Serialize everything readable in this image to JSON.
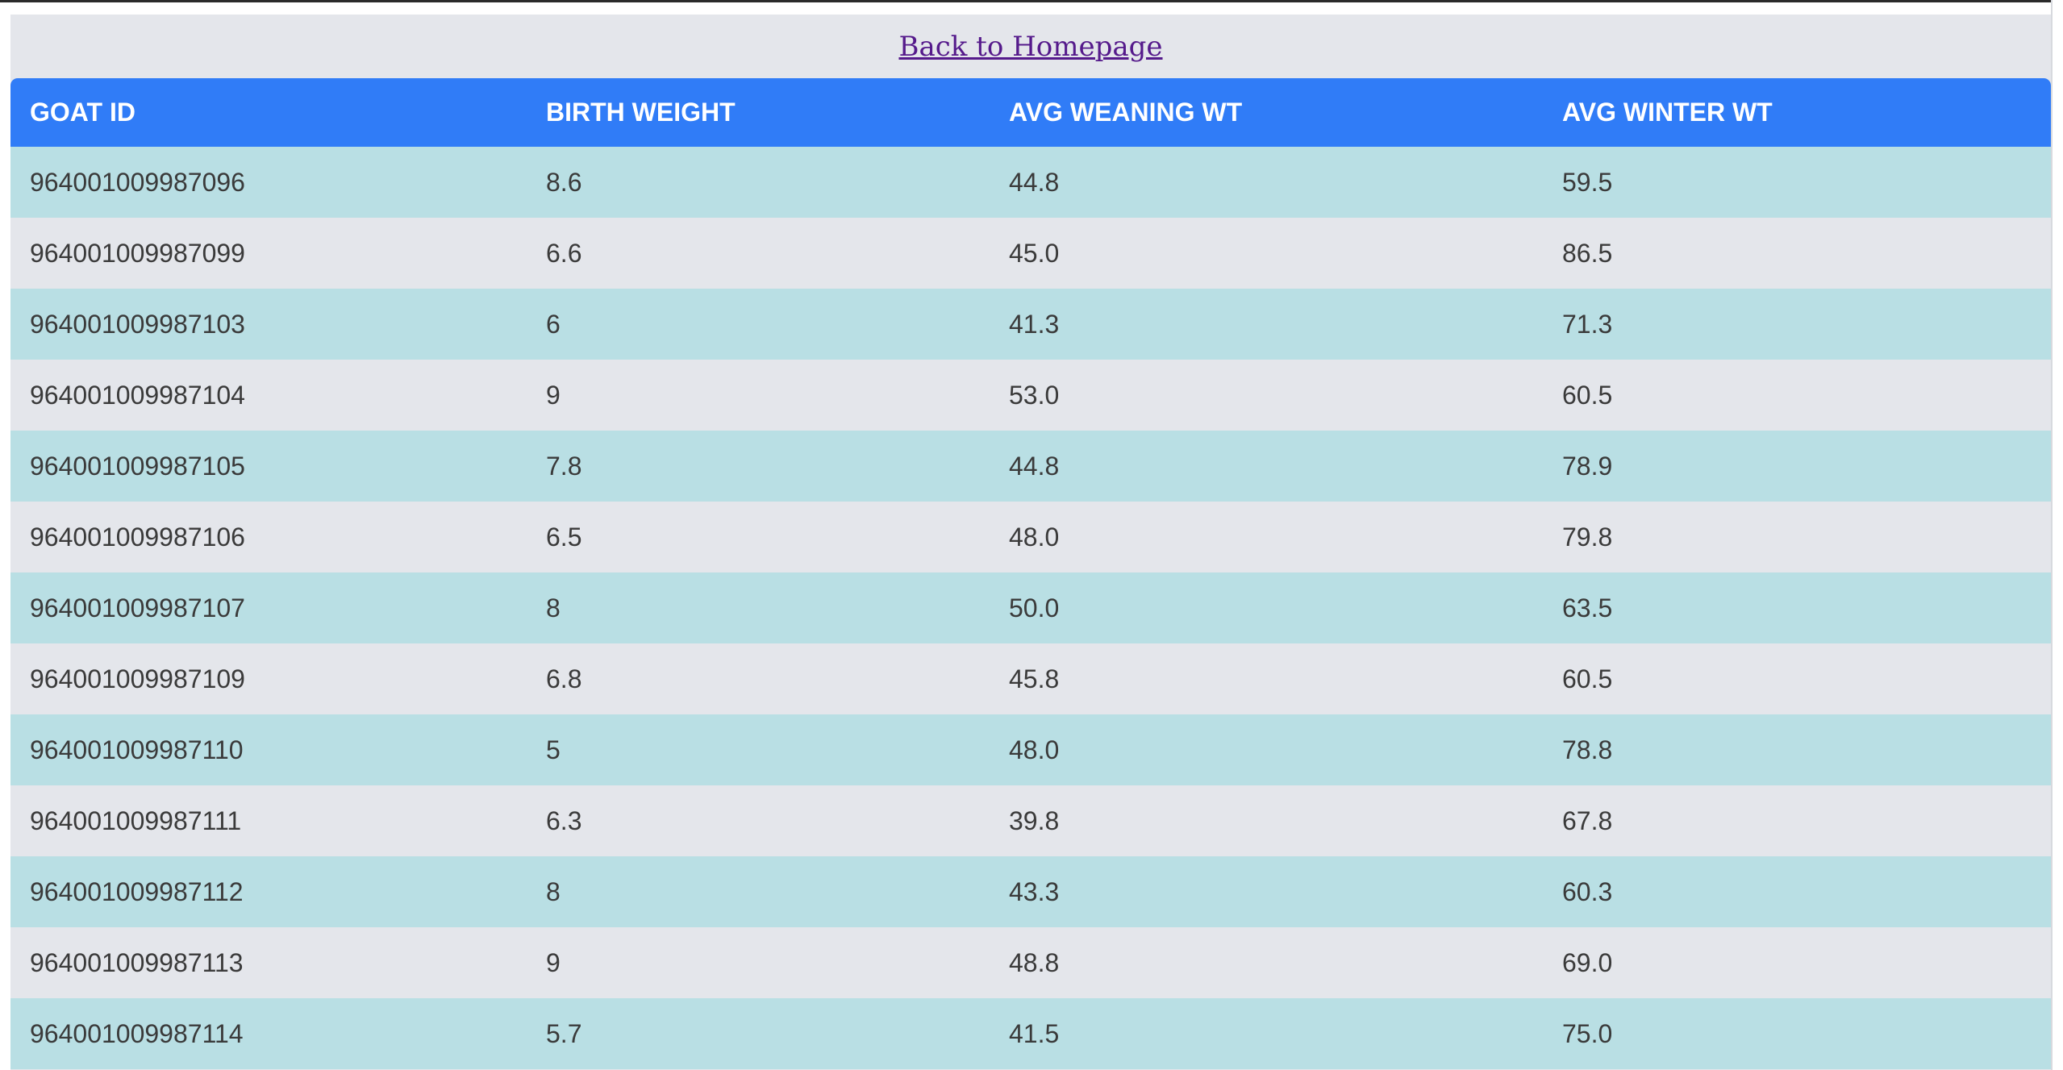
{
  "nav": {
    "back_link": "Back to Homepage"
  },
  "table": {
    "headers": [
      "GOAT ID",
      "BIRTH WEIGHT",
      "AVG WEANING WT",
      "AVG WINTER WT"
    ],
    "rows": [
      [
        "964001009987096",
        "8.6",
        "44.8",
        "59.5"
      ],
      [
        "964001009987099",
        "6.6",
        "45.0",
        "86.5"
      ],
      [
        "964001009987103",
        "6",
        "41.3",
        "71.3"
      ],
      [
        "964001009987104",
        "9",
        "53.0",
        "60.5"
      ],
      [
        "964001009987105",
        "7.8",
        "44.8",
        "78.9"
      ],
      [
        "964001009987106",
        "6.5",
        "48.0",
        "79.8"
      ],
      [
        "964001009987107",
        "8",
        "50.0",
        "63.5"
      ],
      [
        "964001009987109",
        "6.8",
        "45.8",
        "60.5"
      ],
      [
        "964001009987110",
        "5",
        "48.0",
        "78.8"
      ],
      [
        "964001009987111",
        "6.3",
        "39.8",
        "67.8"
      ],
      [
        "964001009987112",
        "8",
        "43.3",
        "60.3"
      ],
      [
        "964001009987113",
        "9",
        "48.8",
        "69.0"
      ],
      [
        "964001009987114",
        "5.7",
        "41.5",
        "75.0"
      ]
    ]
  },
  "colors": {
    "header_bg": "#307cf7",
    "row_odd_bg": "#b9dfe4",
    "row_even_bg": "#e4e6eb",
    "link": "#551a8b"
  }
}
